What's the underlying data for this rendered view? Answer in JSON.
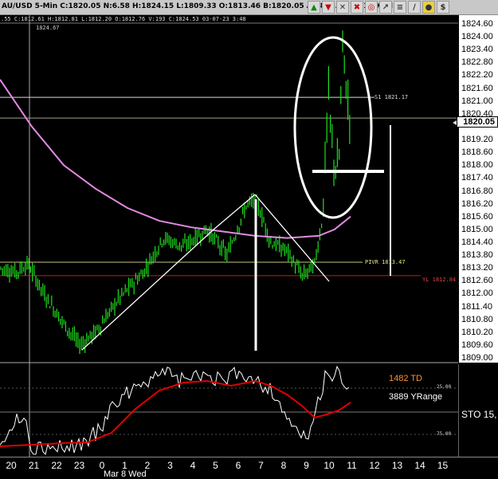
{
  "header": {
    "quote_line": "AU/USD  5-Min  C:1820.05  N:6.58  H:1824.15  L:1809.33  O:1813.46  B:1820.05  A:1820.39  V:41.1K  OI:0",
    "sub_quote_line": ".55  C:1812.61  H:1812.81  L:1812.20  O:1812.76  V:193  C:1824.53  03-07-23  3:48",
    "toolbar_icons": [
      "up-arrow-icon",
      "down-arrow-icon",
      "close-icon",
      "red-x-icon",
      "target-icon",
      "arrow-icon",
      "bars-icon",
      "line-icon",
      "pin-icon",
      "dollar-icon"
    ]
  },
  "price_axis": {
    "labels": [
      "1824.60",
      "1824.00",
      "1823.40",
      "1822.80",
      "1822.20",
      "1821.60",
      "1821.00",
      "1820.40",
      "1819.20",
      "1818.60",
      "1818.00",
      "1817.40",
      "1816.80",
      "1816.20",
      "1815.60",
      "1815.00",
      "1814.40",
      "1813.80",
      "1813.20",
      "1812.60",
      "1812.00",
      "1811.40",
      "1810.80",
      "1810.20",
      "1809.60",
      "1809.00"
    ],
    "current_price": "1820.05"
  },
  "annotations": {
    "top_marker": "1824.67",
    "s1": "S1  1821.17",
    "pivot": "PIVR  1813.47",
    "yl": "YL  1812.84"
  },
  "indicator": {
    "td_label": "1482 TD",
    "yrange_label": "3889 YRange",
    "sto_label": "STO  15,",
    "level_25": "25.00",
    "level_75": "75.00"
  },
  "time_axis": {
    "labels": [
      "20",
      "21",
      "22",
      "23",
      "0",
      "1",
      "2",
      "3",
      "4",
      "5",
      "6",
      "7",
      "8",
      "9",
      "10",
      "11",
      "12",
      "13",
      "14",
      "15"
    ],
    "date_label": "Mar 8 Wed"
  },
  "colors": {
    "candles": "#1fe01f",
    "moving_average": "#e28ae2",
    "stochastic_fast": "#ffffff",
    "stochastic_slow": "#e00000",
    "td_label": "#ff9030"
  }
}
